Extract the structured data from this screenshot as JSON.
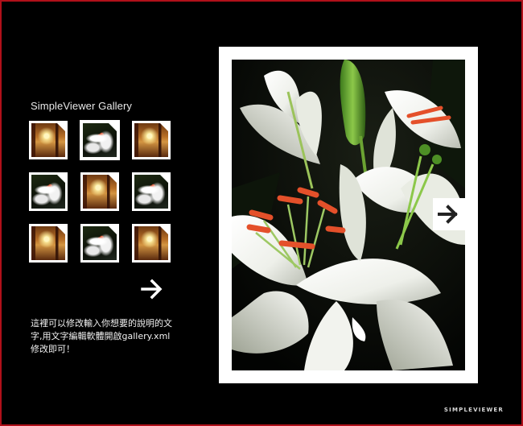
{
  "gallery": {
    "title": "SimpleViewer Gallery",
    "caption": "這裡可以修改輸入你想要的說明的文字,用文字編輯軟體開啟gallery.xml修改即可！",
    "brand": "SIMPLEVIEWER",
    "thumbnails": [
      {
        "subject": "interior",
        "selected": false
      },
      {
        "subject": "lily",
        "selected": true
      },
      {
        "subject": "interior",
        "selected": false
      },
      {
        "subject": "lily",
        "selected": false
      },
      {
        "subject": "interior",
        "selected": false
      },
      {
        "subject": "lily",
        "selected": false
      },
      {
        "subject": "interior",
        "selected": false
      },
      {
        "subject": "lily",
        "selected": false
      },
      {
        "subject": "interior",
        "selected": false
      }
    ]
  },
  "icons": {
    "thumbs_next": "arrow-right-icon",
    "image_next": "arrow-right-icon"
  },
  "colors": {
    "background": "#000000",
    "frame_border": "#b0101a",
    "photo_border": "#ffffff",
    "text": "#ffffff"
  }
}
